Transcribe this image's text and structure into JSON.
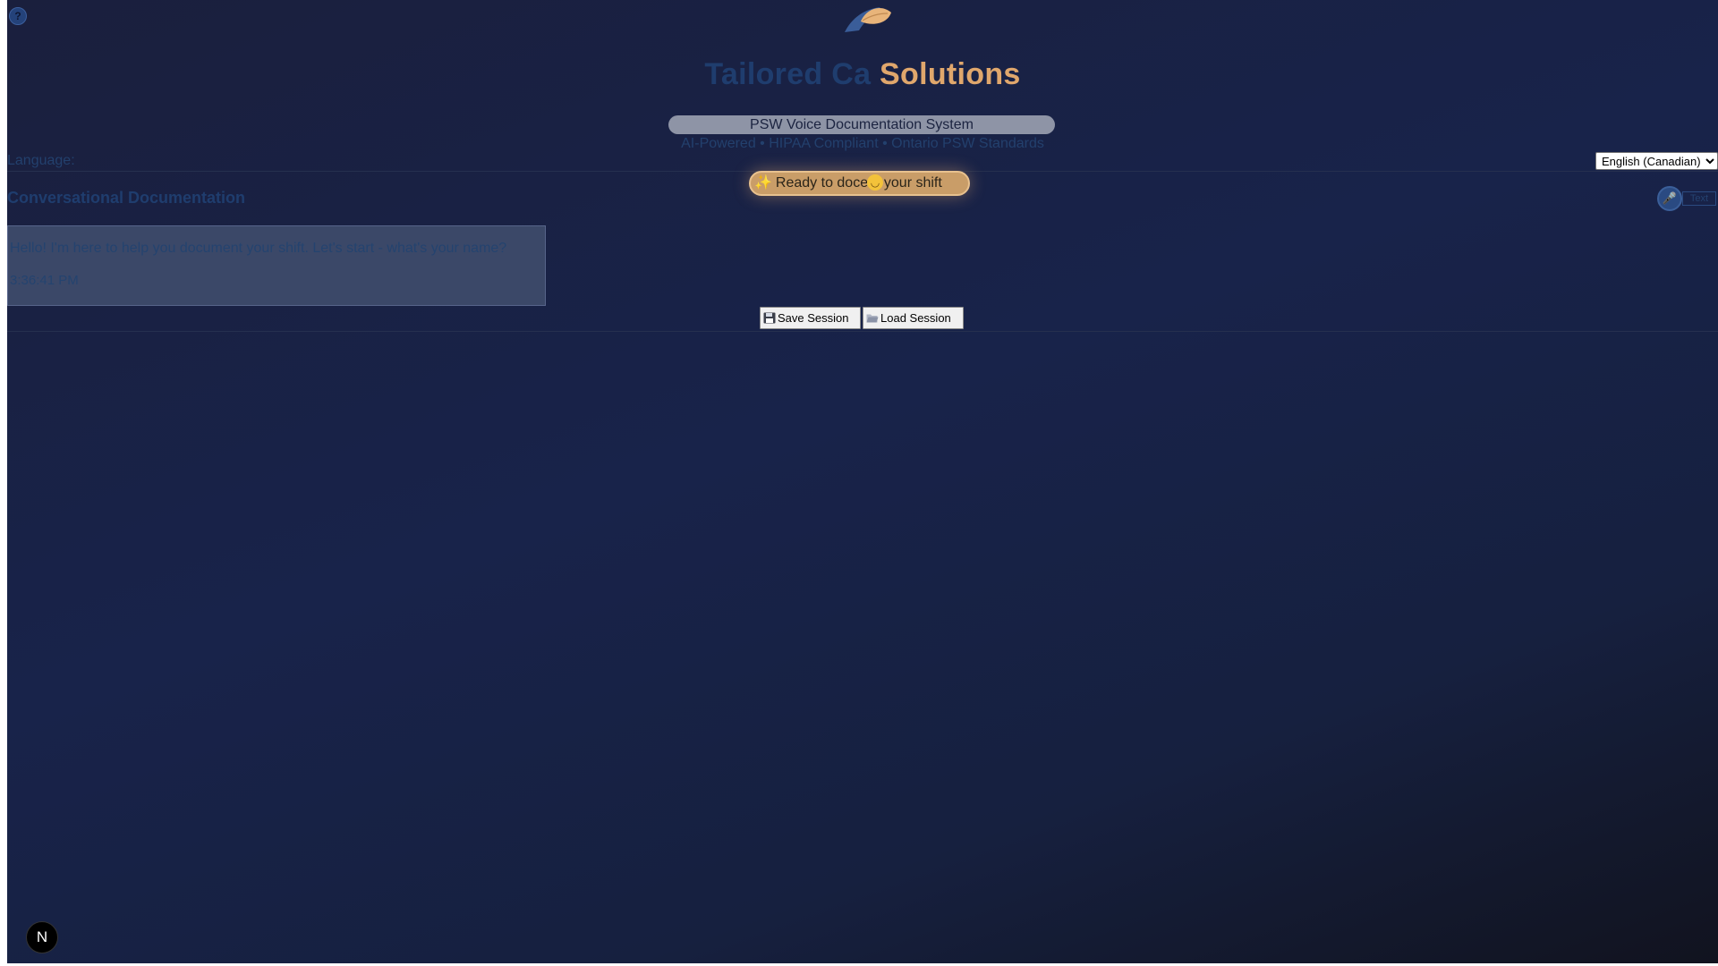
{
  "header": {
    "brand_part1": "Tailored Ca",
    "brand_part2": "Solutions",
    "system_title": "PSW Voice Documentation System",
    "tagline": "AI-Powered • HIPAA Compliant • Ontario PSW Standards"
  },
  "language": {
    "label": "Language:",
    "selected": "English (Canadian)"
  },
  "status": {
    "text_before": "Ready to doc",
    "text_after": "ent your shift",
    "sparkle_icon": "sparkles-icon",
    "face_icon": "smiling-face-icon"
  },
  "conversation": {
    "title": "Conversational Documentation",
    "mic_icon": "microphone-icon",
    "text_mode_label": "Text",
    "messages": [
      {
        "text": "Hello! I'm here to help you document your shift. Let's start - what's your name?",
        "time": "3:36:41 PM"
      }
    ]
  },
  "actions": {
    "save_label": "Save Session",
    "load_label": "Load Session"
  },
  "footer": {
    "badge_letter": "N"
  },
  "colors": {
    "background_top": "#1a1f3d",
    "background_bottom": "#11131f",
    "accent": "#e0a76c",
    "muted_text": "#23406d"
  }
}
